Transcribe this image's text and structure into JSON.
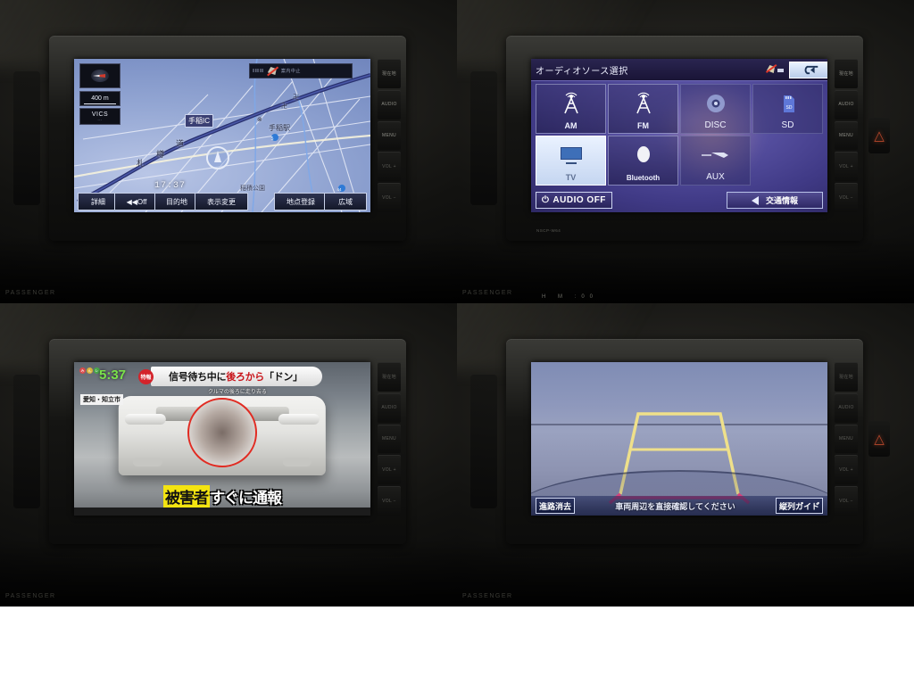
{
  "panels": {
    "nav": {
      "name": "navigation-map",
      "hud": {
        "scale": "400 m",
        "vics_label": "VICS",
        "vics_sub": "---"
      },
      "clock": "17:37",
      "status_bar_text": "案内中止",
      "map_labels": [
        {
          "text": "手稲IC",
          "type": "ic"
        },
        {
          "text": "札",
          "type": "road"
        },
        {
          "text": "樽",
          "type": "road"
        },
        {
          "text": "道",
          "type": "road"
        },
        {
          "text": "手稲駅",
          "type": "poi"
        },
        {
          "text": "稲積公園",
          "type": "poi"
        }
      ],
      "buttons": [
        {
          "label": "詳細"
        },
        {
          "label": "◀◀Off"
        },
        {
          "label": "目的地"
        },
        {
          "label": "表示変更"
        },
        {
          "label": "地点登録"
        },
        {
          "label": "広域"
        }
      ]
    },
    "audio": {
      "name": "audio-source-select",
      "title": "オーディオソース選択",
      "back_label": "戻る",
      "sources": [
        {
          "label": "AM",
          "icon": "antenna-icon",
          "selected": false,
          "style": "framed"
        },
        {
          "label": "FM",
          "icon": "antenna-icon",
          "selected": false,
          "style": "framed"
        },
        {
          "label": "DISC",
          "icon": "disc-icon",
          "selected": false,
          "style": "plain"
        },
        {
          "label": "SD",
          "icon": "sd-card-icon",
          "selected": false,
          "style": "plain"
        },
        {
          "label": "TV",
          "icon": "tv-icon",
          "selected": true,
          "style": "framed"
        },
        {
          "label": "Bluetooth",
          "icon": "bluetooth-icon",
          "selected": false,
          "style": "framed"
        },
        {
          "label": "AUX",
          "icon": "aux-plug-icon",
          "selected": false,
          "style": "plain"
        }
      ],
      "audio_off_label": "AUDIO OFF",
      "traffic_label": "交通情報",
      "model_no": "NSCP-W64"
    },
    "tv": {
      "name": "tv-broadcast",
      "clock": "5:37",
      "badge": "特報",
      "headline_plain_1": "信号待ち中に",
      "headline_red": "後ろから",
      "headline_plain_2": "「ドン」",
      "subline": "クルマの後ろに走り去る",
      "place_tag": "愛知・知立市",
      "caption_highlight": "被害者",
      "caption_rest": "すぐに通報"
    },
    "camera": {
      "name": "rear-view-camera",
      "left_button": "進路消去",
      "warning": "車両周辺を直接確認してください",
      "right_button": "縦列ガ゙イド゙"
    }
  },
  "hardkeys": {
    "right": [
      "現在地",
      "AUDIO",
      "MENU",
      "VOL +",
      "VOL −"
    ],
    "hazard_icon": "hazard-triangle-icon",
    "passenger_label": "PASSENGER",
    "hvac_label": "H M :00"
  },
  "colors": {
    "map_blue": "#93a6d3",
    "audio_purple": "#403a86",
    "guide_yellow": "#f0e08a",
    "guide_red": "#f0427e",
    "caption_yellow": "#f4e411"
  }
}
